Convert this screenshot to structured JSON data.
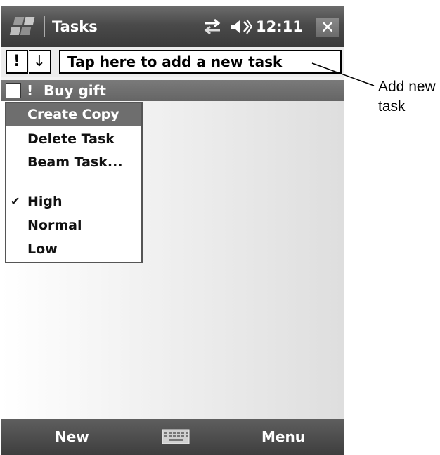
{
  "titlebar": {
    "title": "Tasks",
    "clock": "12:11",
    "close_label": "✕",
    "icons": [
      "windows-start-icon",
      "connectivity-icon",
      "volume-icon",
      "close-icon"
    ]
  },
  "toolbar": {
    "priority_label": "!",
    "sort_label": "↓",
    "add_task_placeholder": "Tap here to add a new task"
  },
  "task": {
    "label": "Buy gift",
    "priority_icon": "!"
  },
  "context_menu": {
    "items": [
      "Create Copy",
      "Delete Task",
      "Beam Task..."
    ],
    "priority_items": [
      "High",
      "Normal",
      "Low"
    ],
    "checked_priority": "High",
    "check_glyph": "✔"
  },
  "menubar": {
    "left_label": "New",
    "right_label": "Menu"
  },
  "callout": {
    "text": "Add new task"
  }
}
